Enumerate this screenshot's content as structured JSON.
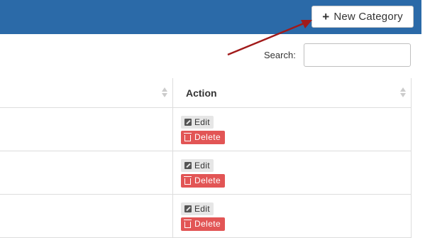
{
  "header": {
    "new_button_label": "New Category",
    "new_button_icon": "plus-icon",
    "background_color": "#2b6aa8"
  },
  "search": {
    "label": "Search:",
    "value": "",
    "placeholder": ""
  },
  "table": {
    "columns": [
      "",
      "Action"
    ],
    "rows": [
      {
        "edit_label": "Edit",
        "delete_label": "Delete"
      },
      {
        "edit_label": "Edit",
        "delete_label": "Delete"
      },
      {
        "edit_label": "Edit",
        "delete_label": "Delete"
      }
    ]
  },
  "annotation": {
    "arrow_color": "#a11a1a"
  },
  "colors": {
    "delete": "#e25555",
    "edit": "#e6e6e6"
  }
}
